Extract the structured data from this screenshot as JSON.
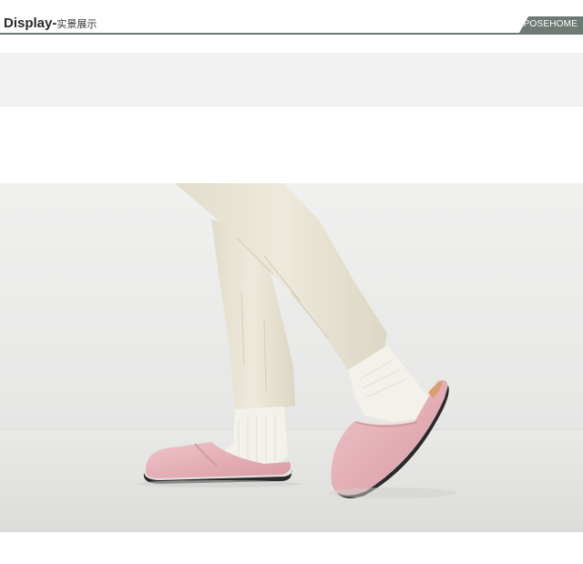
{
  "header": {
    "title": "Display-",
    "subtitle": "实景展示",
    "brand": "POSEHOME"
  },
  "colors": {
    "rule": "#6f7a74",
    "band": "#f2f2f2",
    "wall": "#ebebea",
    "floor": "#e3e3e1",
    "pants": "#e9e3d3",
    "socks": "#f4f2ec",
    "slipper": "#e8b4bc",
    "sole": "#2a2a2a"
  },
  "photo": {
    "subject": "person wearing pink leather slippers"
  }
}
